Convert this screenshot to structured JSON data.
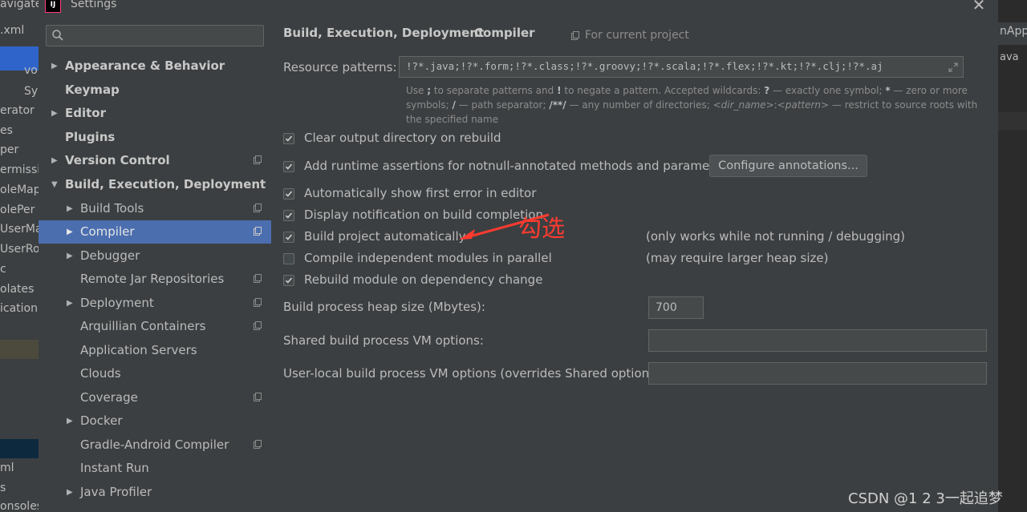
{
  "background_ide": {
    "left_rows": [
      "avigate",
      ".xml",
      "vo",
      "Sy",
      "erator",
      "es",
      "per",
      "ermissi",
      "oleMap",
      "olePer",
      "UserMap",
      "UserRol",
      "c",
      "olates",
      "ication",
      "ml",
      "s",
      "onsoles"
    ],
    "right_rows": [
      "nApp",
      "ava"
    ]
  },
  "dialog": {
    "title": "Settings",
    "app_icon_text": "IJ",
    "close_glyph": "✕"
  },
  "search": {
    "value": "",
    "placeholder": ""
  },
  "nav": {
    "items": [
      {
        "label": "Appearance & Behavior"
      },
      {
        "label": "Keymap"
      },
      {
        "label": "Editor"
      },
      {
        "label": "Plugins"
      },
      {
        "label": "Version Control"
      },
      {
        "label": "Build, Execution, Deployment"
      },
      {
        "label": "Build Tools"
      },
      {
        "label": "Compiler"
      },
      {
        "label": "Debugger"
      },
      {
        "label": "Remote Jar Repositories"
      },
      {
        "label": "Deployment"
      },
      {
        "label": "Arquillian Containers"
      },
      {
        "label": "Application Servers"
      },
      {
        "label": "Clouds"
      },
      {
        "label": "Coverage"
      },
      {
        "label": "Docker"
      },
      {
        "label": "Gradle-Android Compiler"
      },
      {
        "label": "Instant Run"
      },
      {
        "label": "Java Profiler"
      }
    ]
  },
  "panel": {
    "breadcrumb": [
      "Build, Execution, Deployment",
      "Compiler"
    ],
    "breadcrumb_sep": "›",
    "for_current_project": "For current project",
    "resource_patterns_label": "Resource patterns:",
    "resource_patterns_value": "!?*.java;!?*.form;!?*.class;!?*.groovy;!?*.scala;!?*.flex;!?*.kt;!?*.clj;!?*.aj",
    "hint": {
      "p1": "Use ",
      "b1": ";",
      "p2": " to separate patterns and ",
      "b2": "!",
      "p3": " to negate a pattern. Accepted wildcards: ",
      "b3": "?",
      "p4": " — exactly one symbol; ",
      "b4": "*",
      "p5": " — zero or more symbols; ",
      "b5": "/",
      "p6": " — path separator; ",
      "b6": "/**/",
      "p7": " — any number of directories; ",
      "i1": "<dir_name>",
      "p8": ":",
      "i2": "<pattern>",
      "p9": " — restrict to source roots with the specified name"
    },
    "options": [
      {
        "label": "Clear output directory on rebuild",
        "checked": true
      },
      {
        "label": "Add runtime assertions for notnull-annotated methods and parameters",
        "checked": true
      },
      {
        "label": "Automatically show first error in editor",
        "checked": true
      },
      {
        "label": "Display notification on build completion",
        "checked": true
      },
      {
        "label": "Build project automatically",
        "checked": true
      },
      {
        "label": "Compile independent modules in parallel",
        "checked": false
      },
      {
        "label": "Rebuild module on dependency change",
        "checked": true
      }
    ],
    "configure_annotations_button": "Configure annotations...",
    "note_build_auto": "(only works while not running / debugging)",
    "note_parallel": "(may require larger heap size)",
    "heap_label": "Build process heap size (Mbytes):",
    "heap_value": "700",
    "shared_vm_label": "Shared build process VM options:",
    "shared_vm_value": "",
    "user_vm_label": "User-local build process VM options (overrides Shared options):",
    "user_vm_value": ""
  },
  "annotation": {
    "text": "勾选",
    "color": "#ff3b30"
  },
  "watermark": "CSDN @1 2 3一起追梦"
}
